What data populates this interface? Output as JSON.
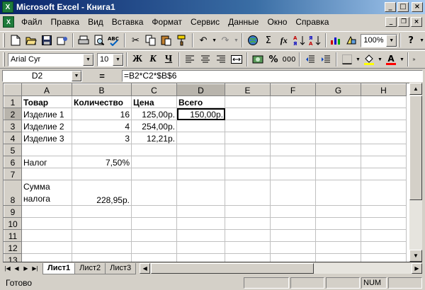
{
  "window": {
    "title": "Microsoft Excel - Книга1",
    "minimize": "_",
    "maximize": "□",
    "close": "×",
    "app_icon": "excel-icon"
  },
  "menu": {
    "items": [
      "Файл",
      "Правка",
      "Вид",
      "Вставка",
      "Формат",
      "Сервис",
      "Данные",
      "Окно",
      "Справка"
    ],
    "doc_minimize": "_",
    "doc_restore": "❐",
    "doc_close": "×"
  },
  "toolbar": {
    "zoom": "100%",
    "help": "?",
    "sum_symbol": "Σ",
    "fx_symbol": "fx"
  },
  "format_toolbar": {
    "font_name": "Arial Cyr",
    "font_size": "10",
    "bold": "Ж",
    "italic": "К",
    "underline": "Ч",
    "percent": "%",
    "thousands": "000",
    "font_color": "A",
    "font_color_hex": "#ff0000",
    "fill_color_hex": "#ffff00"
  },
  "formula_bar": {
    "name_box": "D2",
    "equals": "=",
    "formula": "=B2*C2*$B$6"
  },
  "sheet": {
    "columns": [
      "A",
      "B",
      "C",
      "D",
      "E",
      "F",
      "G",
      "H"
    ],
    "active_column": "D",
    "active_row": "2",
    "rows": [
      {
        "num": "1",
        "cells": [
          "Товар",
          "Количество",
          "Цена",
          "Всего",
          "",
          "",
          "",
          ""
        ]
      },
      {
        "num": "2",
        "cells": [
          "Изделие 1",
          "16",
          "125,00р.",
          "150,00р.",
          "",
          "",
          "",
          ""
        ]
      },
      {
        "num": "3",
        "cells": [
          "Изделие 2",
          "4",
          "254,00р.",
          "",
          "",
          "",
          "",
          ""
        ]
      },
      {
        "num": "4",
        "cells": [
          "Изделие 3",
          "3",
          "12,21р.",
          "",
          "",
          "",
          "",
          ""
        ]
      },
      {
        "num": "5",
        "cells": [
          "",
          "",
          "",
          "",
          "",
          "",
          "",
          ""
        ]
      },
      {
        "num": "6",
        "cells": [
          "Налог",
          "7,50%",
          "",
          "",
          "",
          "",
          "",
          ""
        ]
      },
      {
        "num": "7",
        "cells": [
          "",
          "",
          "",
          "",
          "",
          "",
          "",
          ""
        ]
      },
      {
        "num": "8",
        "cells": [
          "Сумма налога",
          "228,95р.",
          "",
          "",
          "",
          "",
          "",
          ""
        ]
      },
      {
        "num": "9",
        "cells": [
          "",
          "",
          "",
          "",
          "",
          "",
          "",
          ""
        ]
      },
      {
        "num": "10",
        "cells": [
          "",
          "",
          "",
          "",
          "",
          "",
          "",
          ""
        ]
      },
      {
        "num": "11",
        "cells": [
          "",
          "",
          "",
          "",
          "",
          "",
          "",
          ""
        ]
      },
      {
        "num": "12",
        "cells": [
          "",
          "",
          "",
          "",
          "",
          "",
          "",
          ""
        ]
      },
      {
        "num": "13",
        "cells": [
          "",
          "",
          "",
          "",
          "",
          "",
          "",
          ""
        ]
      }
    ]
  },
  "tabs": [
    "Лист1",
    "Лист2",
    "Лист3"
  ],
  "active_tab": "Лист1",
  "status": {
    "text": "Готово",
    "num": "NUM"
  }
}
